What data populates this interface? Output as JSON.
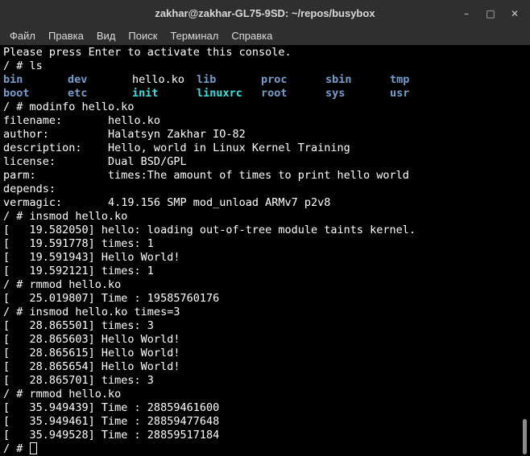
{
  "window": {
    "title": "zakhar@zakhar-GL75-9SD: ~/repos/busybox",
    "buttons": {
      "minimize": "–",
      "maximize": "□",
      "close": "✕"
    }
  },
  "menu": {
    "items": [
      "Файл",
      "Правка",
      "Вид",
      "Поиск",
      "Терминал",
      "Справка"
    ]
  },
  "colors": {
    "background": "#000000",
    "text": "#ffffff",
    "directory": "#729fcf",
    "symlink": "#34e2e2",
    "chrome": "#2f2f2f"
  },
  "terminal": {
    "pre_lines": [
      "Please press Enter to activate this console.",
      "/ # ls"
    ],
    "ls_rows": [
      [
        {
          "name": "bin",
          "type": "dir"
        },
        {
          "name": "dev",
          "type": "dir"
        },
        {
          "name": "hello.ko",
          "type": "file"
        },
        {
          "name": "lib",
          "type": "dir"
        },
        {
          "name": "proc",
          "type": "dir"
        },
        {
          "name": "sbin",
          "type": "dir"
        },
        {
          "name": "tmp",
          "type": "dir"
        }
      ],
      [
        {
          "name": "boot",
          "type": "dir"
        },
        {
          "name": "etc",
          "type": "dir"
        },
        {
          "name": "init",
          "type": "link"
        },
        {
          "name": "linuxrc",
          "type": "link"
        },
        {
          "name": "root",
          "type": "dir"
        },
        {
          "name": "sys",
          "type": "dir"
        },
        {
          "name": "usr",
          "type": "dir"
        }
      ]
    ],
    "post_lines": [
      "/ # modinfo hello.ko",
      "filename:       hello.ko",
      "author:         Halatsyn Zakhar IO-82",
      "description:    Hello, world in Linux Kernel Training",
      "license:        Dual BSD/GPL",
      "parm:           times:The amount of times to print hello world",
      "depends:",
      "vermagic:       4.19.156 SMP mod_unload ARMv7 p2v8",
      "/ # insmod hello.ko",
      "[   19.582050] hello: loading out-of-tree module taints kernel.",
      "[   19.591778] times: 1",
      "[   19.591943] Hello World!",
      "[   19.592121] times: 1",
      "/ # rmmod hello.ko",
      "[   25.019807] Time : 19585760176",
      "/ # insmod hello.ko times=3",
      "[   28.865501] times: 3",
      "[   28.865603] Hello World!",
      "[   28.865615] Hello World!",
      "[   28.865654] Hello World!",
      "[   28.865701] times: 3",
      "/ # rmmod hello.ko",
      "[   35.949439] Time : 28859461600",
      "[   35.949461] Time : 28859477648",
      "[   35.949528] Time : 28859517184"
    ],
    "prompt": "/ # "
  }
}
